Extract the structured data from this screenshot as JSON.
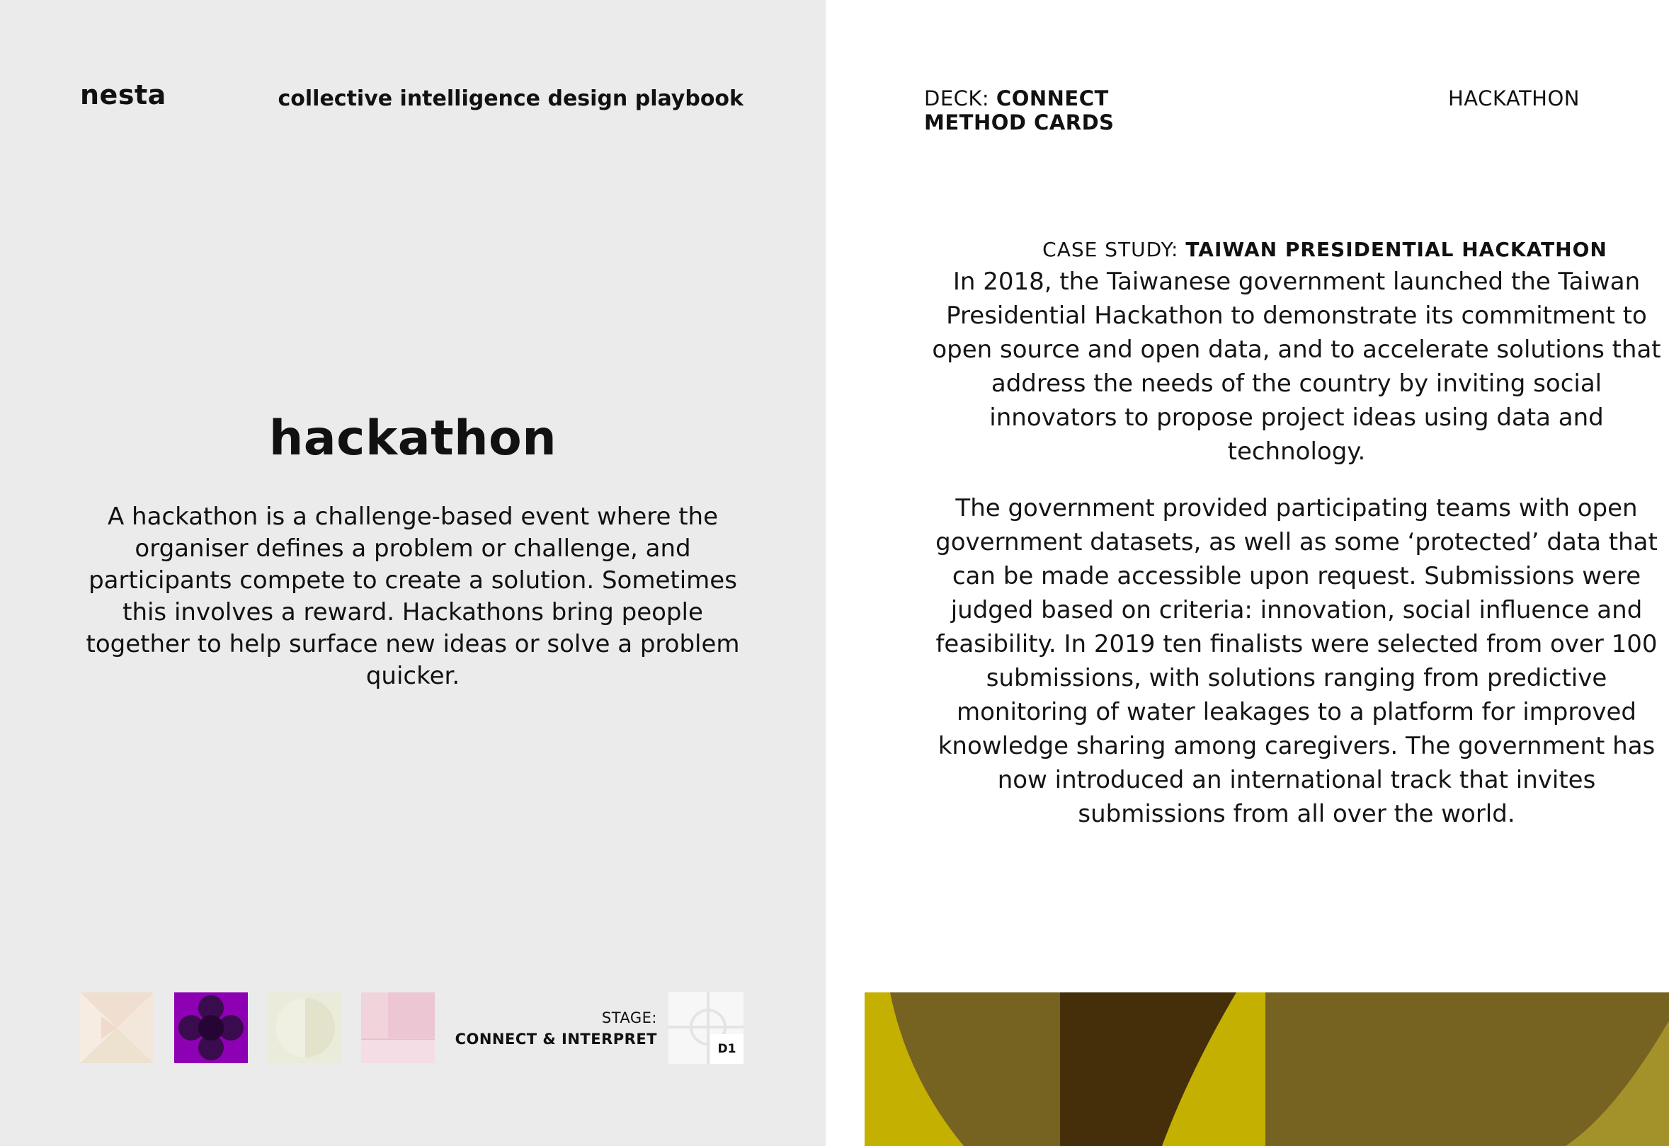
{
  "left": {
    "brand": "nesta",
    "playbook_title": "collective intelligence design playbook",
    "method_title": "hackathon",
    "method_description": "A hackathon is a challenge-based event where the organiser defines a problem or challenge, and participants compete to create a solution. Sometimes this involves a reward. Hackathons bring people together to help surface new ideas or solve a problem quicker.",
    "stage_label": "STAGE:",
    "stage_value": "CONNECT & INTERPRET",
    "card_code": "D1",
    "thumbnails": [
      {
        "icon": "envelope-pattern-icon",
        "active": false
      },
      {
        "icon": "four-circles-pattern-icon",
        "active": true,
        "color": "#8e00b3"
      },
      {
        "icon": "half-circle-pattern-icon",
        "active": false
      },
      {
        "icon": "grid-squares-pattern-icon",
        "active": false
      }
    ]
  },
  "right": {
    "deck_prefix": "DECK: ",
    "deck_name": "CONNECT",
    "deck_sub": "METHOD CARDS",
    "card_name": "HACKATHON",
    "case_prefix": "CASE STUDY: ",
    "case_title": "TAIWAN PRESIDENTIAL HACKATHON",
    "paragraph_1": "In 2018, the Taiwanese government launched the Taiwan Presidential Hackathon to demonstrate its commitment to open source and open data, and to accelerate solutions that address the needs of the country by inviting social innovators to propose project ideas using data and technology.",
    "paragraph_2": "The government provided participating teams with open government datasets, as well as some ‘protected’ data that can be made accessible upon request. Submissions were judged based on criteria: innovation, social influence and feasibility. In 2019 ten finalists were selected from over 100 submissions, with solutions ranging from predictive monitoring of water leakages to a platform for improved knowledge sharing among caregivers. The government has now introduced an international track that invites submissions from all over the world."
  },
  "colors": {
    "left_bg": "#ebebeb",
    "accent_purple": "#8e00b3",
    "band_olive": "#766322",
    "band_yellow": "#c4b000",
    "band_dark": "#452f0b"
  }
}
